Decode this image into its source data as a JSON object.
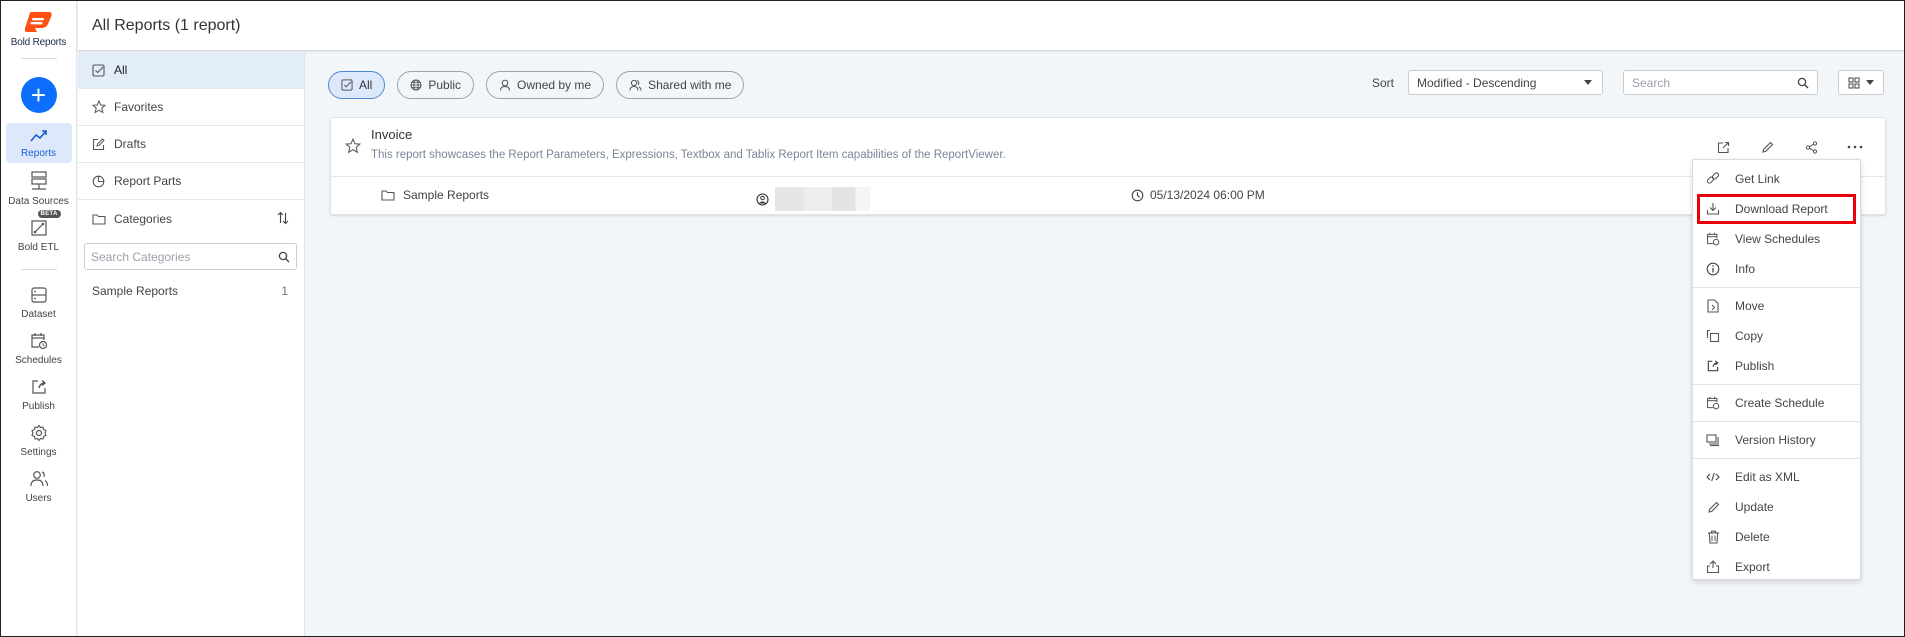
{
  "brand": {
    "name": "Bold Reports",
    "color": "#ff4f12"
  },
  "rail": {
    "add_label": "+",
    "items": [
      {
        "label": "Reports",
        "icon": "trend-icon",
        "active": true
      },
      {
        "label": "Data Sources",
        "icon": "server-icon"
      },
      {
        "label": "Bold ETL",
        "icon": "etl-icon",
        "badge": "BETA"
      },
      {
        "label": "Dataset",
        "icon": "dataset-icon"
      },
      {
        "label": "Schedules",
        "icon": "calendar-clock-icon"
      },
      {
        "label": "Publish",
        "icon": "publish-icon"
      },
      {
        "label": "Settings",
        "icon": "gear-icon"
      },
      {
        "label": "Users",
        "icon": "users-icon"
      }
    ]
  },
  "header": {
    "title": "All Reports (1 report)"
  },
  "sidebar": {
    "items": [
      {
        "label": "All",
        "icon": "checkbox-icon",
        "active": true
      },
      {
        "label": "Favorites",
        "icon": "star-icon"
      },
      {
        "label": "Drafts",
        "icon": "edit-icon"
      },
      {
        "label": "Report Parts",
        "icon": "pie-icon"
      },
      {
        "label": "Categories",
        "icon": "folder-icon"
      }
    ],
    "category_search_placeholder": "Search Categories",
    "categories": [
      {
        "name": "Sample Reports",
        "count": "1"
      }
    ]
  },
  "filters": [
    {
      "label": "All",
      "icon": "checkbox-icon",
      "active": true
    },
    {
      "label": "Public",
      "icon": "globe-icon"
    },
    {
      "label": "Owned by me",
      "icon": "user-icon"
    },
    {
      "label": "Shared with me",
      "icon": "users-icon"
    }
  ],
  "sort": {
    "label": "Sort",
    "selected": "Modified - Descending"
  },
  "search": {
    "placeholder": "Search"
  },
  "report": {
    "name": "Invoice",
    "description": "This report showcases the Report Parameters, Expressions, Textbox and Tablix Report Item capabilities of the ReportViewer.",
    "category": "Sample Reports",
    "modified": "05/13/2024 06:00 PM"
  },
  "context_menu": {
    "groups": [
      [
        {
          "label": "Get Link",
          "icon": "link-icon"
        },
        {
          "label": "Download Report",
          "icon": "download-icon",
          "highlighted": true
        },
        {
          "label": "View Schedules",
          "icon": "calendar-clock-icon"
        },
        {
          "label": "Info",
          "icon": "info-icon"
        }
      ],
      [
        {
          "label": "Move",
          "icon": "move-icon"
        },
        {
          "label": "Copy",
          "icon": "copy-icon"
        },
        {
          "label": "Publish",
          "icon": "publish-icon"
        }
      ],
      [
        {
          "label": "Create Schedule",
          "icon": "calendar-clock-icon"
        }
      ],
      [
        {
          "label": "Version History",
          "icon": "version-icon"
        }
      ],
      [
        {
          "label": "Edit as XML",
          "icon": "code-icon"
        },
        {
          "label": "Update",
          "icon": "pencil-icon"
        },
        {
          "label": "Delete",
          "icon": "trash-icon"
        },
        {
          "label": "Export",
          "icon": "export-icon"
        }
      ]
    ]
  },
  "colors": {
    "accent": "#0d6efd",
    "highlight_border": "#e8000b",
    "active_bg": "#dde9fb"
  }
}
